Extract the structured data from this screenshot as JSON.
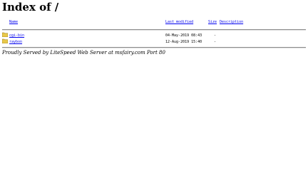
{
  "title": "Index of /",
  "columns": {
    "name": "Name",
    "last_modified": "Last modified",
    "size": "Size",
    "description": "Description"
  },
  "rows": [
    {
      "icon": "folder-icon",
      "name": "cgi-bin",
      "last_modified": "04-May-2019 08:43",
      "size": "-",
      "description": ""
    },
    {
      "icon": "folder-icon",
      "name": "raybon",
      "last_modified": "12-Aug-2019 15:40",
      "size": "-",
      "description": ""
    }
  ],
  "footer": "Proudly Served by LiteSpeed Web Server at msfairy.com Port 80",
  "colors": {
    "link": "#0000ee",
    "folder": "#e8c84a",
    "rule": "#8c8c8c"
  }
}
